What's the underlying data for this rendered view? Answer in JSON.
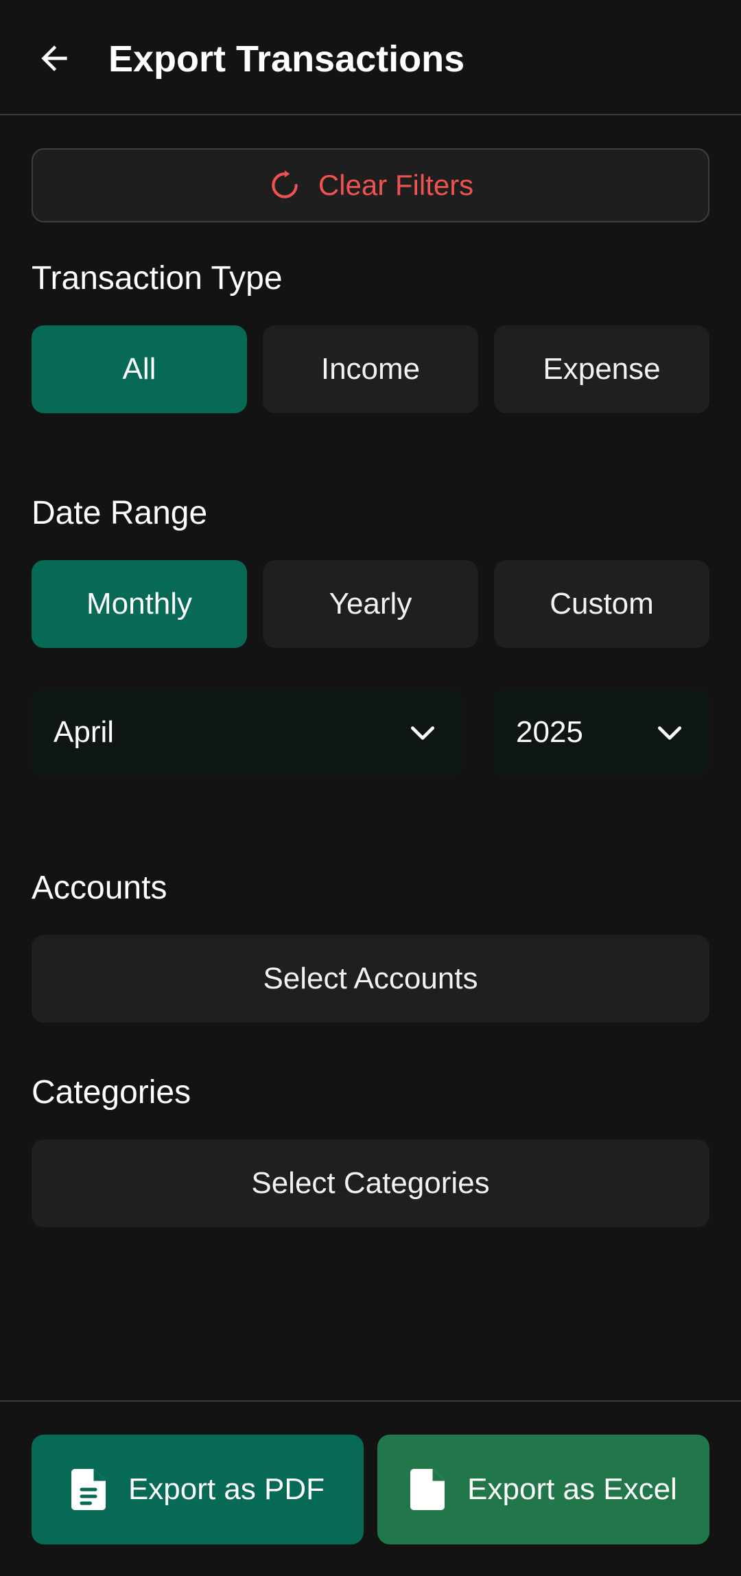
{
  "header": {
    "title": "Export Transactions",
    "back_icon": "arrow-left-icon"
  },
  "clear_filters": {
    "label": "Clear Filters",
    "icon": "refresh-icon",
    "color": "#ef5350"
  },
  "transaction_type": {
    "label": "Transaction Type",
    "options": [
      "All",
      "Income",
      "Expense"
    ],
    "selected": "All"
  },
  "date_range": {
    "label": "Date Range",
    "options": [
      "Monthly",
      "Yearly",
      "Custom"
    ],
    "selected": "Monthly",
    "month": "April",
    "year": "2025"
  },
  "accounts": {
    "label": "Accounts",
    "button": "Select Accounts"
  },
  "categories": {
    "label": "Categories",
    "button": "Select Categories"
  },
  "export": {
    "pdf_label": "Export as PDF",
    "excel_label": "Export as Excel",
    "pdf_icon": "document-icon",
    "excel_icon": "file-icon"
  },
  "colors": {
    "accent": "#066a56",
    "excel": "#22774a",
    "background": "#131313",
    "surface": "#1f1f1f"
  }
}
